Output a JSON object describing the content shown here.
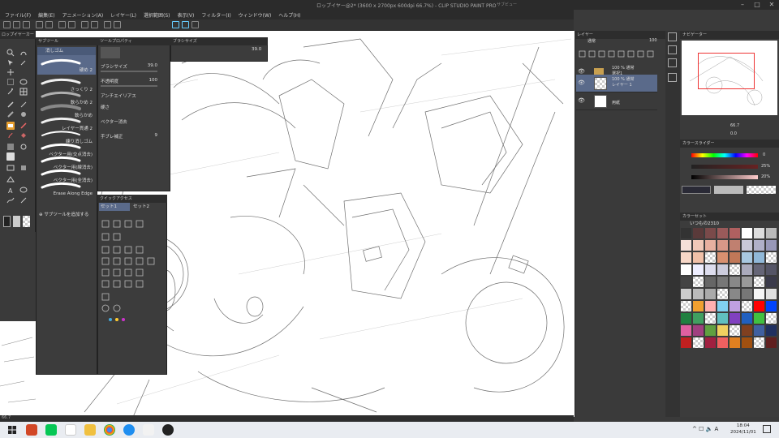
{
  "title": {
    "window": "ロップイヤー@2* (3600 x 2700px 600dpi 66.7%) - CLIP STUDIO PAINT PRO",
    "sub_window": "サブビュー"
  },
  "menu": [
    "ファイル(F)",
    "編集(E)",
    "アニメーション(A)",
    "レイヤー(L)",
    "選択範囲(S)",
    "表示(V)",
    "フィルター(I)",
    "ウィンドウ(W)",
    "ヘルプ(H)"
  ],
  "toolbox": {
    "header": "ロップイヤーカー"
  },
  "subtool": {
    "header": "サブツール",
    "group": "消しゴム",
    "items": [
      {
        "label": "硬め 2"
      },
      {
        "label": "さっくり 2"
      },
      {
        "label": "軟らかめ 2"
      },
      {
        "label": "軟らかめ"
      },
      {
        "label": "レイヤー貫通 2"
      },
      {
        "label": "練り消しゴム"
      },
      {
        "label": "ベクター用(交点消去)"
      },
      {
        "label": "ベクター用(線消去)"
      },
      {
        "label": "ベクター用(全消去)"
      },
      {
        "label": "Erase Along Edge"
      }
    ],
    "add_label": "サブツールを追加する"
  },
  "brush_props": {
    "header": "ツールプロパティ",
    "size_label": "ブラシサイズ",
    "size_value": "39.0",
    "hardness_label": "不透明度",
    "hardness_value": "100",
    "hardness2_label": "硬さ",
    "antialias_label": "アンチエイリアス",
    "vector_label": "ベクター消去",
    "stabilization_label": "手ブレ補正",
    "stabilization_value": "9"
  },
  "brush_size_panel": {
    "header": "ブラシサイズ",
    "value": "39.0"
  },
  "command_palette": {
    "header": "クイックアクセス",
    "tab1": "セット1",
    "tab2": "セット2"
  },
  "layers": {
    "header": "レイヤー",
    "blend_mode": "通常",
    "opacity": "100",
    "items": [
      {
        "name": "100 % 通常",
        "sub": "選択1"
      },
      {
        "name": "100 % 通常",
        "sub": "レイヤー 1"
      },
      {
        "name": "",
        "sub": "用紙"
      }
    ]
  },
  "navigator": {
    "header": "ナビゲーター",
    "zoom": "66.7",
    "angle": "0.0"
  },
  "color_slider": {
    "header": "カラースライダー",
    "values": [
      "0",
      "25%",
      "20%"
    ]
  },
  "color_set": {
    "header": "カラーセット",
    "name": "いつもの2310"
  },
  "status": {
    "zoom": "66.7"
  },
  "clock": {
    "time": "18:04",
    "date": "2024/11/01"
  }
}
